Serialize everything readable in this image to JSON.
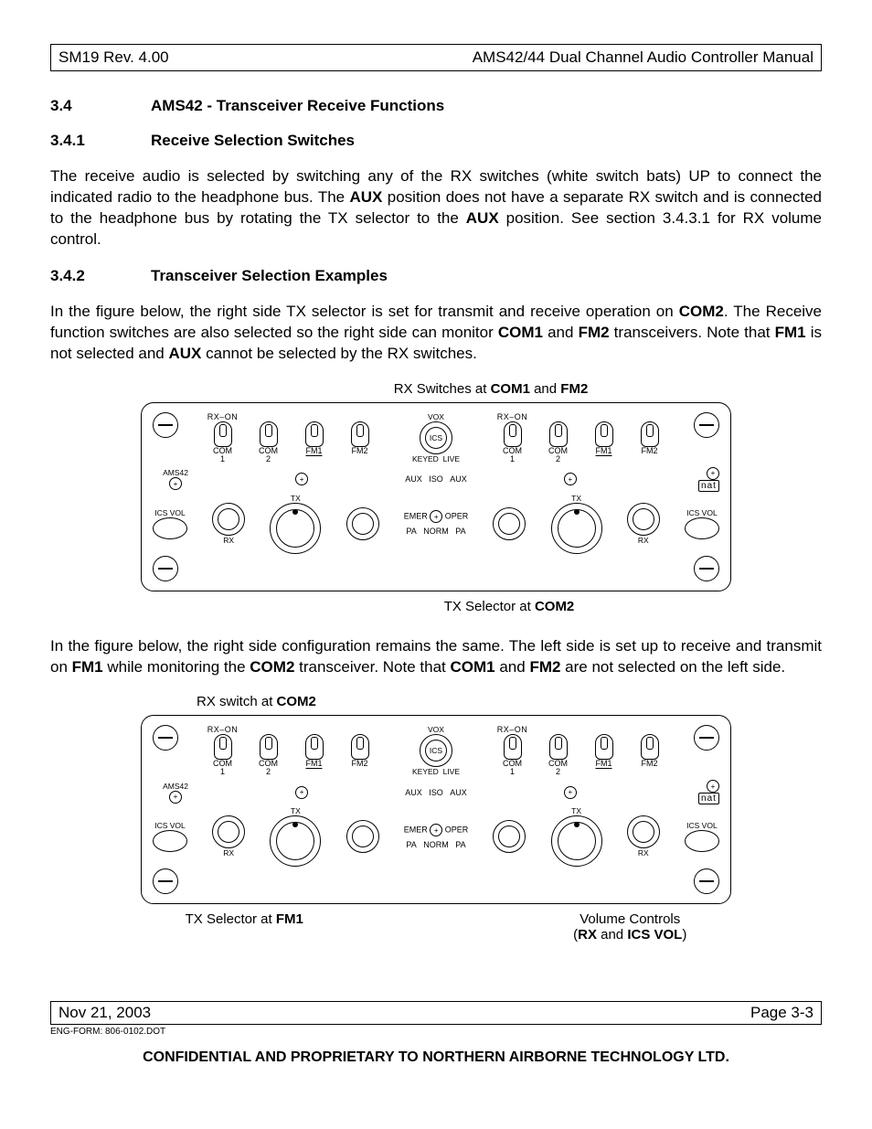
{
  "header": {
    "left": "SM19 Rev. 4.00",
    "right": "AMS42/44 Dual Channel Audio Controller Manual"
  },
  "sec34": {
    "num": "3.4",
    "title": "AMS42 - Transceiver Receive Functions"
  },
  "sec341": {
    "num": "3.4.1",
    "title": "Receive Selection Switches"
  },
  "para341_a": "The receive audio is selected by switching any of the RX switches (white switch bats) UP to connect the indicated radio to the headphone bus.  The ",
  "para341_b": " position does not have a separate RX switch and is connected to the headphone bus by rotating the TX selector to the ",
  "para341_c": " position. See section 3.4.3.1 for RX volume control.",
  "aux": "AUX",
  "sec342": {
    "num": "3.4.2",
    "title": "Transceiver Selection Examples"
  },
  "para342a_a": "In the figure below, the right side TX selector is set for transmit and receive operation on ",
  "para342a_b": ".  The Receive function switches are also selected so the right side can monitor ",
  "para342a_c": " and ",
  "para342a_d": " transceivers.  Note that ",
  "para342a_e": " is not selected and ",
  "para342a_f": " cannot be selected by the RX switches.",
  "com1": "COM1",
  "com2": "COM2",
  "fm1": "FM1",
  "fm2": "FM2",
  "fig1_topcap_a": "RX  Switches at ",
  "fig1_topcap_b": " and ",
  "fig1_botcap_a": "TX Selector at ",
  "para342b_a": "In the figure below, the right side configuration remains the same.  The left side is set up to receive and transmit on ",
  "para342b_b": " while monitoring the ",
  "para342b_c": " transceiver.  Note that ",
  "para342b_d": " and ",
  "para342b_e": " are not selected on the left side.",
  "fig2_topcap_a": "RX switch at ",
  "fig2_bot1_a": "TX Selector at ",
  "fig2_bot2_a": "Volume Controls",
  "fig2_bot2_b_a": "(",
  "fig2_bot2_b_b": " and ",
  "fig2_bot2_b_c": ")",
  "rx": "RX",
  "icsvol": "ICS VOL",
  "panel": {
    "device": "AMS42",
    "rx_on": "RX–ON",
    "vox": "VOX",
    "ics": "ICS",
    "com1_s": "COM",
    "com2_s": "COM",
    "fm1_s": "FM1",
    "fm2_s": "FM2",
    "n1": "1",
    "n2": "2",
    "keyed": "KEYED",
    "live": "LIVE",
    "aux": "AUX",
    "iso": "ISO",
    "emer": "EMER",
    "oper": "OPER",
    "pa": "PA",
    "norm": "NORM",
    "ics_vol": "ICS  VOL",
    "tx": "TX",
    "rx": "RX",
    "nat": "nat"
  },
  "footer": {
    "left": "Nov 21, 2003",
    "right": "Page 3-3",
    "form": "ENG-FORM: 806-0102.DOT"
  },
  "confidential": "CONFIDENTIAL AND PROPRIETARY TO NORTHERN AIRBORNE TECHNOLOGY LTD."
}
